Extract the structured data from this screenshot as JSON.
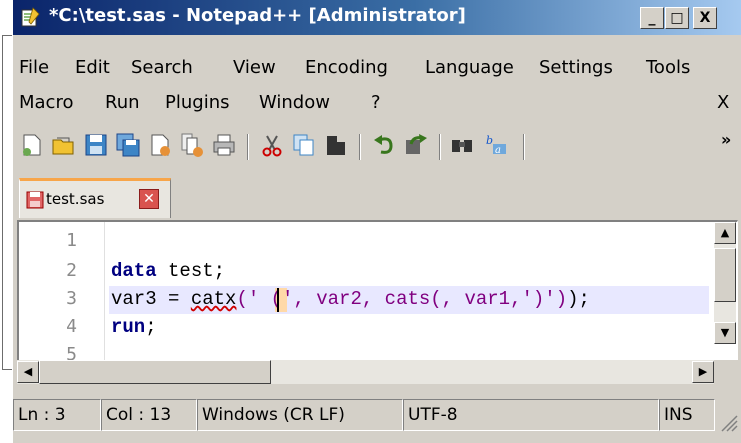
{
  "window": {
    "title": "*C:\\test.sas - Notepad++ [Administrator]",
    "buttons": {
      "minimize": "_",
      "maximize": "□",
      "close": "X"
    }
  },
  "menu": {
    "row1": [
      "File",
      "Edit",
      "Search",
      "View",
      "Encoding",
      "Language",
      "Settings",
      "Tools"
    ],
    "row2": [
      "Macro",
      "Run",
      "Plugins",
      "Window",
      "?"
    ],
    "close_label": "X"
  },
  "toolbar": {
    "icons": [
      "new-file-icon",
      "open-folder-icon",
      "save-icon",
      "save-all-icon",
      "close-file-icon",
      "close-all-icon",
      "print-icon",
      "cut-icon",
      "copy-icon",
      "paste-icon",
      "undo-icon",
      "redo-icon",
      "find-icon",
      "replace-icon"
    ],
    "overflow_label": "»"
  },
  "tab": {
    "label": "test.sas",
    "close_label": "✕"
  },
  "editor": {
    "line_numbers": [
      "1",
      "2",
      "3",
      "4",
      "5"
    ],
    "lines": {
      "l2_kw": "data",
      "l2_rest": " test;",
      "l3_a": "var3 = ",
      "l3_fn": "catx",
      "l3_b": "(' (', var2, cats(, var1,')')",
      "l3_c": ");",
      "l4_kw": "run",
      "l4_rest": ";"
    }
  },
  "statusbar": {
    "line": "Ln : 3",
    "col": "Col : 13",
    "eol": "Windows (CR LF)",
    "encoding": "UTF-8",
    "mode": "INS"
  },
  "colors": {
    "titlebar_start": "#0a246a",
    "titlebar_end": "#a6caf0",
    "keyword": "#000080",
    "string": "#800080",
    "current_line": "#e8e8ff",
    "tab_accent": "#f7a54a"
  }
}
